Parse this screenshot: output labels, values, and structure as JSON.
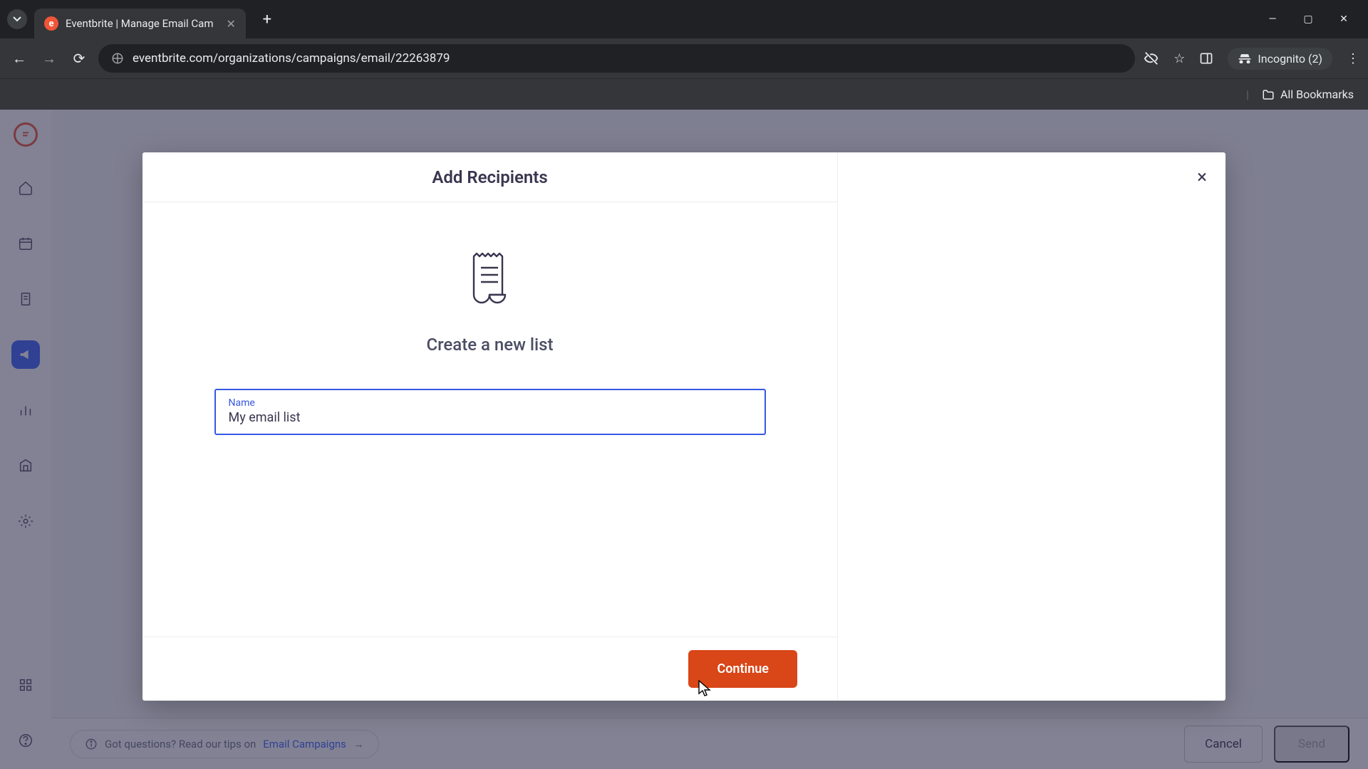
{
  "browser": {
    "tab_title": "Eventbrite | Manage Email Cam",
    "url": "eventbrite.com/organizations/campaigns/email/22263879",
    "incognito_label": "Incognito (2)",
    "all_bookmarks": "All Bookmarks"
  },
  "bottom": {
    "tips_prefix": "Got questions? Read our tips on ",
    "tips_link": "Email Campaigns",
    "cancel": "Cancel",
    "send": "Send"
  },
  "modal": {
    "title": "Add Recipients",
    "subheading": "Create a new list",
    "input_label": "Name",
    "input_value": "My email list",
    "continue": "Continue"
  }
}
